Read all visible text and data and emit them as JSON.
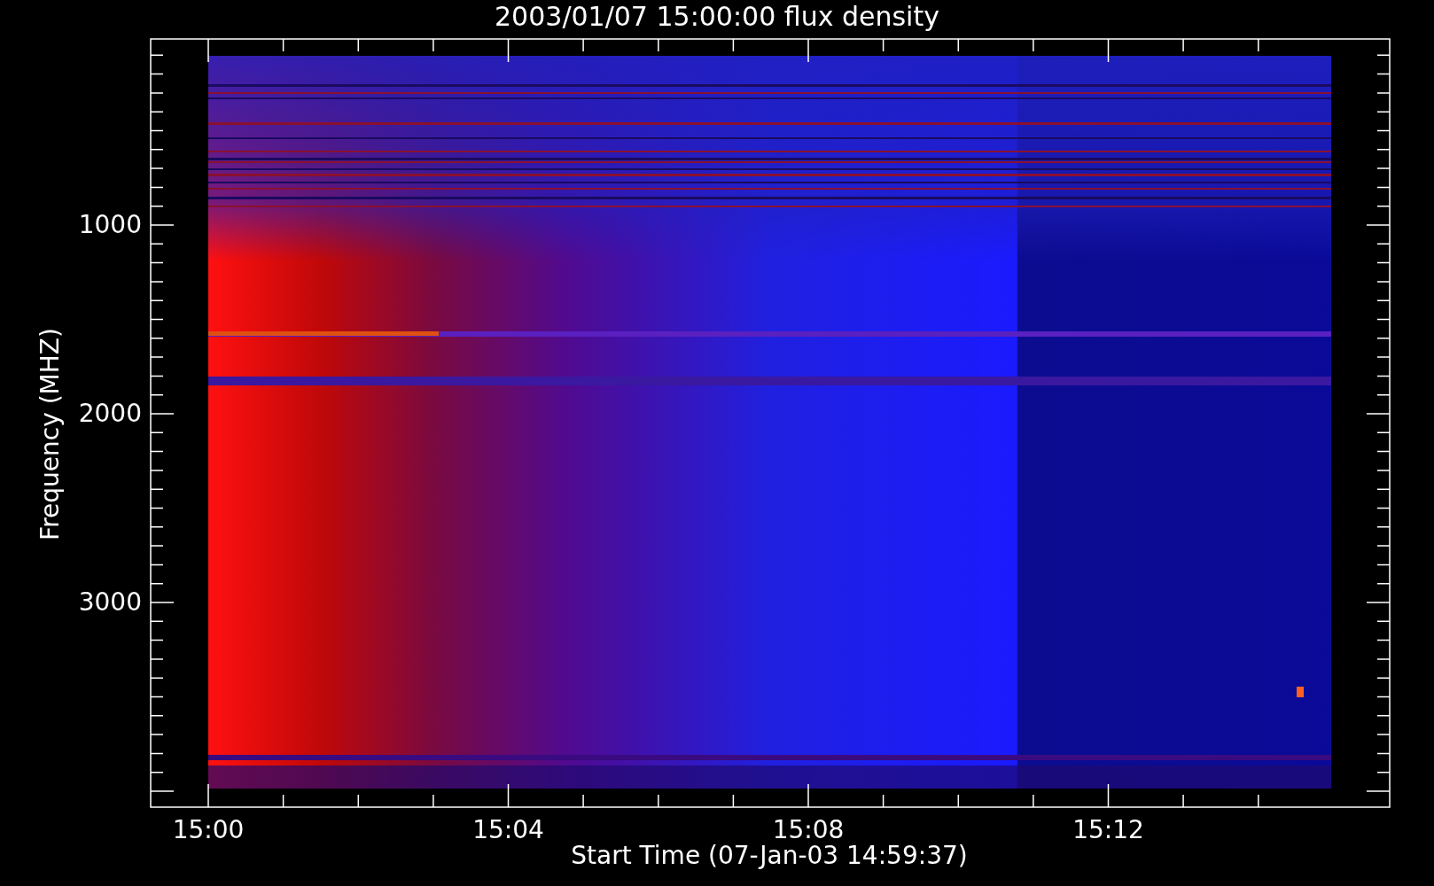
{
  "title": "2003/01/07 15:00:00 flux density",
  "y_axis": {
    "label": "Frequency (MHZ)",
    "ticks": [
      "1000",
      "2000",
      "3000"
    ]
  },
  "x_axis": {
    "label": "Start Time (07-Jan-03 14:59:37)",
    "ticks": [
      "15:00",
      "15:04",
      "15:08",
      "15:12"
    ]
  }
}
